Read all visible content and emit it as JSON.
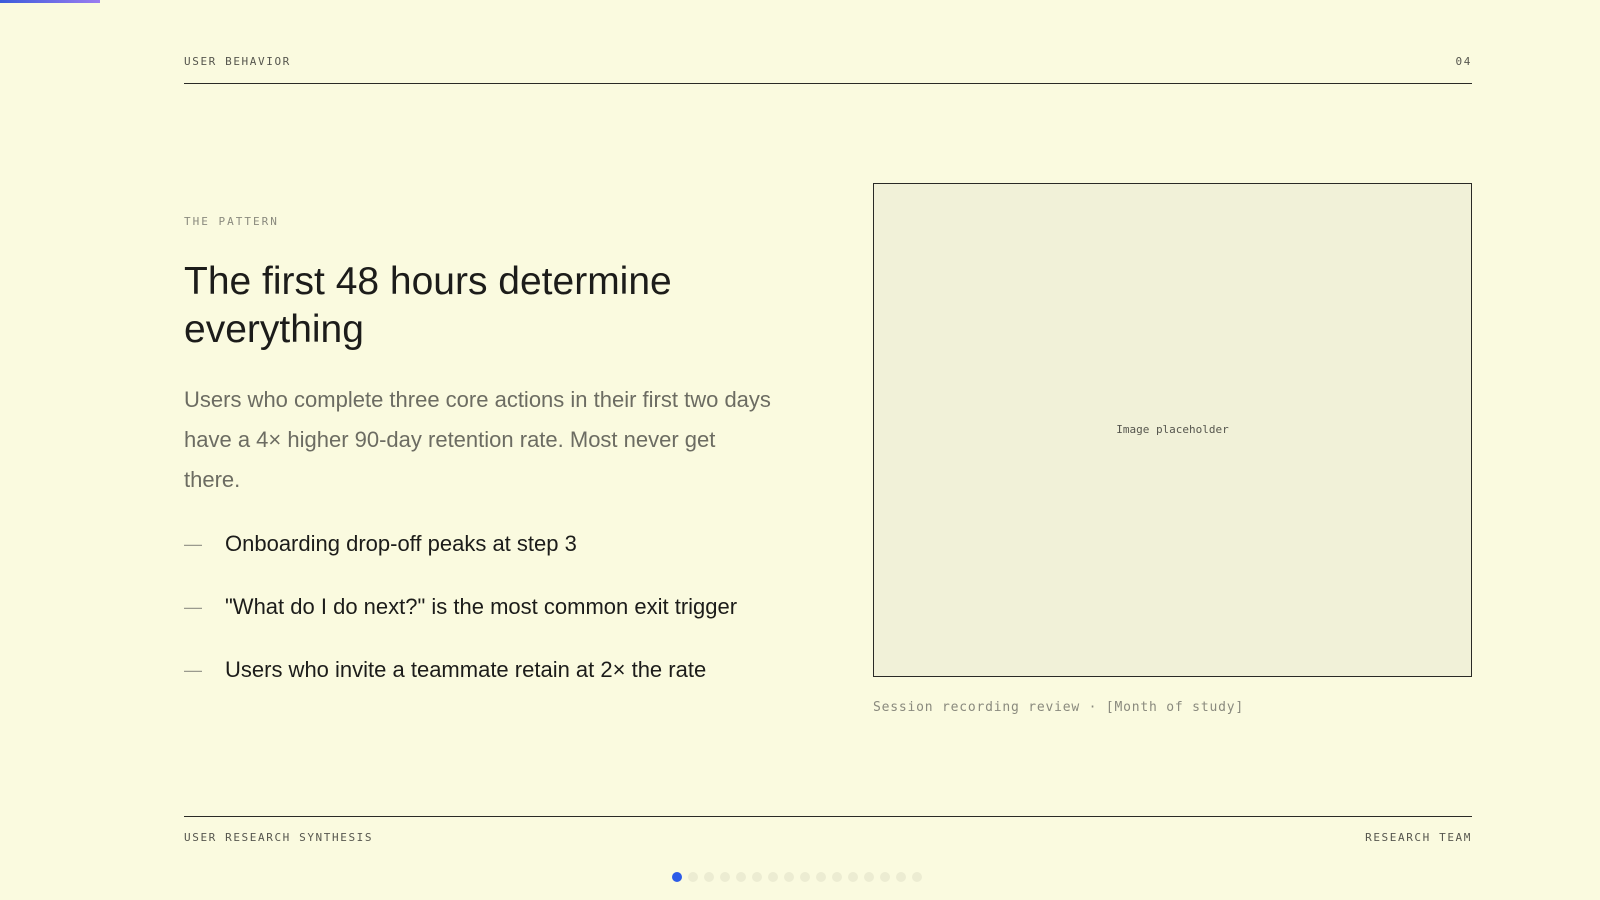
{
  "header": {
    "section": "USER BEHAVIOR",
    "page_number": "04"
  },
  "content": {
    "eyebrow": "THE PATTERN",
    "title": "The first 48 hours determine everything",
    "lede": "Users who complete three core actions in their first two days have a 4× higher 90-day retention rate. Most never get there.",
    "bullet_marker": "—",
    "bullets": [
      "Onboarding drop-off peaks at step 3",
      "\"What do I do next?\" is the most common exit trigger",
      "Users who invite a teammate retain at 2× the rate"
    ]
  },
  "media": {
    "placeholder_label": "Image placeholder",
    "caption": "Session recording review · [Month of study]"
  },
  "footer": {
    "left": "USER RESEARCH SYNTHESIS",
    "right": "RESEARCH TEAM"
  },
  "navigation": {
    "slide_count": 16,
    "active_slide": 1
  },
  "colors": {
    "background": "#fafadf",
    "accent": "#2c5be8",
    "text": "#1c1c1a",
    "muted": "#6c6c62"
  }
}
